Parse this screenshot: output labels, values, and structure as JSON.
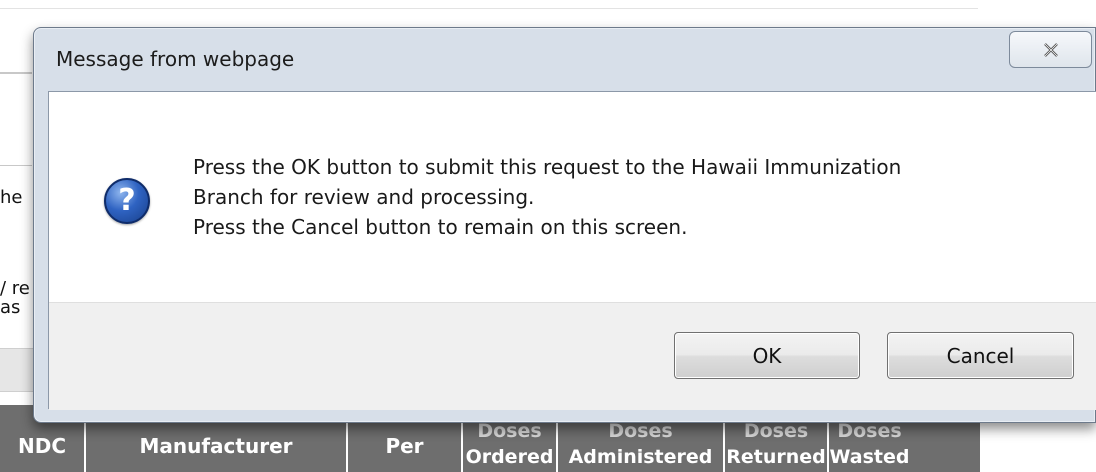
{
  "background": {
    "fragments": [
      "he",
      "/ re",
      "as",
      ""
    ],
    "table_headers": [
      {
        "line1": "",
        "line2": "NDC"
      },
      {
        "line1": "",
        "line2": "Manufacturer"
      },
      {
        "line1": "",
        "line2": "Per"
      },
      {
        "line1": "Doses",
        "line2": "Ordered"
      },
      {
        "line1": "Doses",
        "line2": "Administered"
      },
      {
        "line1": "Doses",
        "line2": "Returned"
      },
      {
        "line1": "Doses",
        "line2": "Wasted"
      }
    ],
    "colors": {
      "table_header": "#6e6e6e"
    }
  },
  "dialog": {
    "title": "Message from webpage",
    "icon": "question-icon",
    "icon_glyph": "?",
    "close_icon": "close-icon",
    "message_lines": [
      "Press the OK button to submit this request to the Hawaii Immunization",
      "Branch for review and processing.",
      "Press the Cancel button to remain on this screen."
    ],
    "buttons": {
      "ok": "OK",
      "cancel": "Cancel"
    },
    "colors": {
      "frame": "#d7dfe9",
      "footer": "#f0f0f0",
      "icon": "#2f63c2"
    }
  }
}
